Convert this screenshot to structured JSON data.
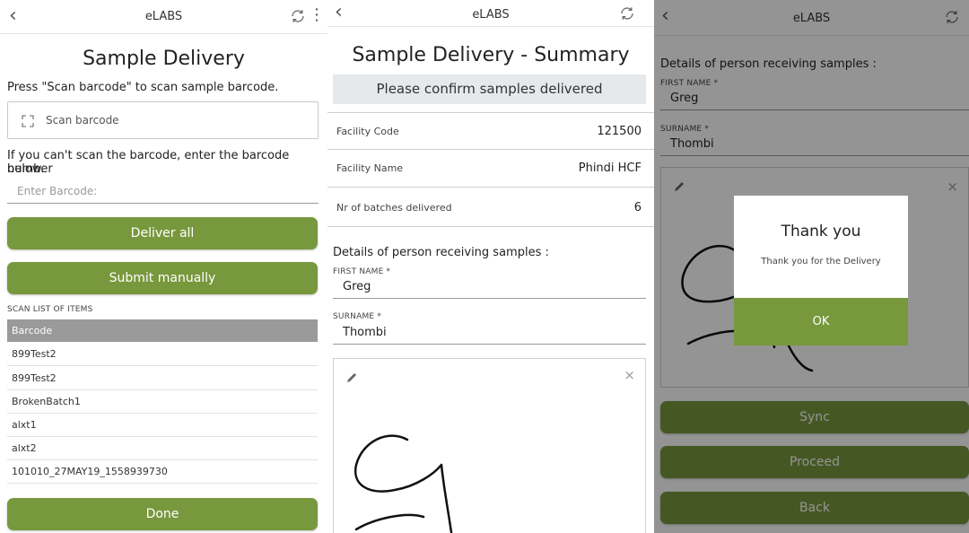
{
  "app_title": "eLABS",
  "sample_delivery": {
    "heading": "Sample Delivery",
    "instruction": "Press \"Scan barcode\" to scan sample barcode.",
    "scan_button": "Scan barcode",
    "manual_hint_1": "If you can't scan the barcode, enter the barcode number",
    "manual_hint_2": "below.",
    "barcode_placeholder": "Enter Barcode:",
    "deliver_all": "Deliver all",
    "submit_manually": "Submit manually",
    "scan_list_title": "SCAN LIST OF ITEMS",
    "list_header": "Barcode",
    "items": [
      "899Test2",
      "899Test2",
      "BrokenBatch1",
      "alxt1",
      "alxt2",
      "101010_27MAY19_1558939730"
    ],
    "done": "Done"
  },
  "summary": {
    "heading": "Sample Delivery - Summary",
    "banner": "Please confirm samples delivered",
    "rows": [
      {
        "label": "Facility Code",
        "value": "121500"
      },
      {
        "label": "Facility Name",
        "value": "Phindi HCF"
      },
      {
        "label": "Nr of batches delivered",
        "value": "6"
      }
    ],
    "receiver_title": "Details of person receiving samples :",
    "first_name_label": "FIRST NAME *",
    "first_name": "Greg",
    "surname_label": "SURNAME *",
    "surname": "Thombi"
  },
  "confirm": {
    "receiver_title": "Details of person receiving samples :",
    "first_name_label": "FIRST NAME *",
    "first_name": "Greg",
    "surname_label": "SURNAME *",
    "surname": "Thombi",
    "sync": "Sync",
    "proceed": "Proceed",
    "back": "Back",
    "dialog": {
      "title": "Thank you",
      "message": "Thank you for the Delivery",
      "ok": "OK"
    }
  },
  "colors": {
    "accent_green": "#78983d",
    "banner_gray": "#e6e9ec",
    "list_header_gray": "#9a9a9a"
  },
  "icons": [
    "back-chevron-icon",
    "sync-icon",
    "more-vert-icon",
    "scan-frame-icon",
    "pencil-icon",
    "close-icon"
  ]
}
